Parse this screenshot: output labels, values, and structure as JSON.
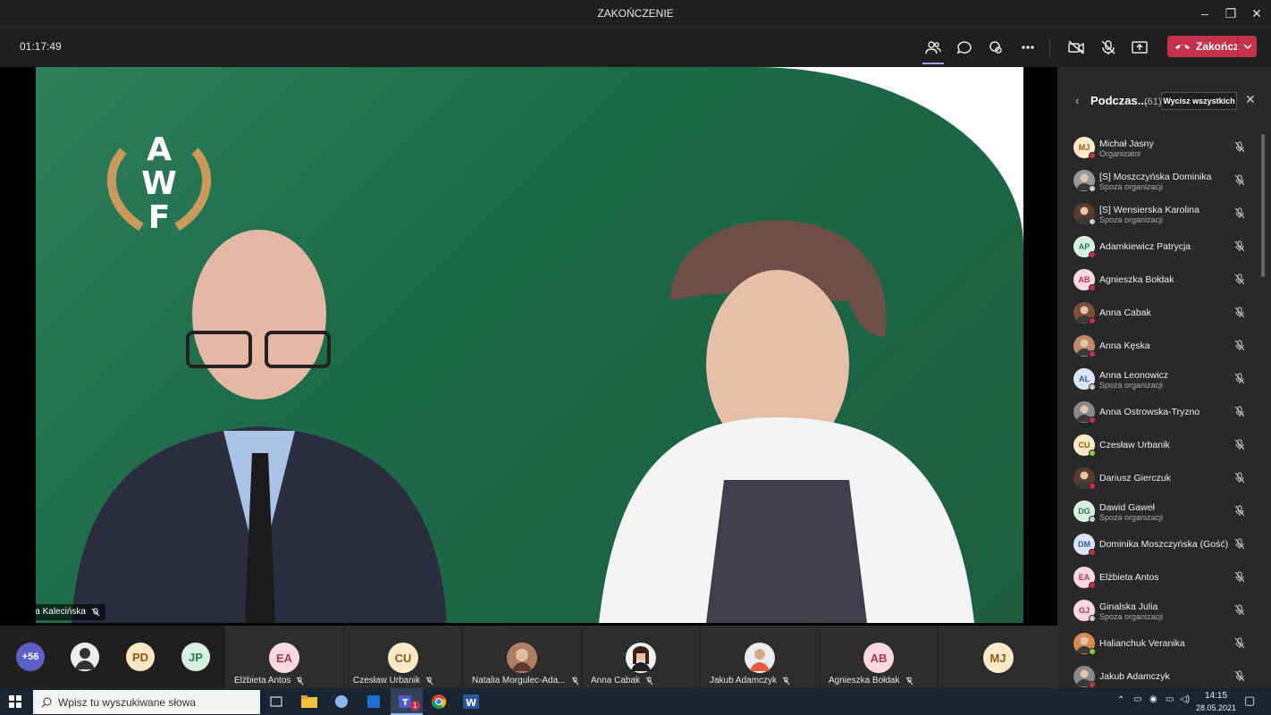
{
  "window": {
    "title": "ZAKOŃCZENIE"
  },
  "callbar": {
    "timer": "01:17:49",
    "end_label": "Zakończ"
  },
  "stage": {
    "speaker_name": "Joanna Kalecińska",
    "logo_text": "AWF"
  },
  "strip": {
    "overflow_count": "+56",
    "small_avatars": [
      "PD",
      "JP"
    ],
    "tiles": [
      {
        "initials": "EA",
        "name": "Elżbieta Antos"
      },
      {
        "initials": "CU",
        "name": "Czesław Urbanik"
      },
      {
        "initials": "",
        "name": "Natalia Morgulec-Ada..."
      },
      {
        "initials": "",
        "name": "Anna Cabak"
      },
      {
        "initials": "",
        "name": "Jakub Adamczyk"
      },
      {
        "initials": "AB",
        "name": "Agnieszka Bołdak"
      },
      {
        "initials": "MJ",
        "name": ""
      }
    ]
  },
  "panel": {
    "title": "Podczas...",
    "count": "(61)",
    "mute_all_label": "Wycisz wszystkich",
    "participants": [
      {
        "initials": "MJ",
        "name": "Michał Jasny",
        "sub": "Organizator"
      },
      {
        "initials": "",
        "name": "[S] Moszczyńska Dominika",
        "sub": "Spoza organizacji"
      },
      {
        "initials": "",
        "name": "[S] Wensierska Karolina",
        "sub": "Spoza organizacji"
      },
      {
        "initials": "AP",
        "name": "Adamkiewicz Patrycja",
        "sub": ""
      },
      {
        "initials": "AB",
        "name": "Agnieszka Bołdak",
        "sub": ""
      },
      {
        "initials": "",
        "name": "Anna Cabak",
        "sub": ""
      },
      {
        "initials": "",
        "name": "Anna Kęska",
        "sub": ""
      },
      {
        "initials": "AL",
        "name": "Anna Leonowicz",
        "sub": "Spoza organizacji"
      },
      {
        "initials": "",
        "name": "Anna Ostrowska-Tryzno",
        "sub": ""
      },
      {
        "initials": "CU",
        "name": "Czesław Urbanik",
        "sub": ""
      },
      {
        "initials": "",
        "name": "Dariusz Gierczuk",
        "sub": ""
      },
      {
        "initials": "DG",
        "name": "Dawid Gaweł",
        "sub": "Spoza organizacji"
      },
      {
        "initials": "DM",
        "name": "Dominika Moszczyńska (Gość)",
        "sub": ""
      },
      {
        "initials": "EA",
        "name": "Elżbieta Antos",
        "sub": ""
      },
      {
        "initials": "GJ",
        "name": "Ginalska Julia",
        "sub": "Spoza organizacji"
      },
      {
        "initials": "",
        "name": "Halianchuk Veranika",
        "sub": ""
      },
      {
        "initials": "",
        "name": "Jakub Adamczyk",
        "sub": ""
      }
    ]
  },
  "taskbar": {
    "search_placeholder": "Wpisz tu wyszukiwane słowa",
    "time": "14:15",
    "date": "28.05.2021",
    "teams_badge": "1"
  }
}
